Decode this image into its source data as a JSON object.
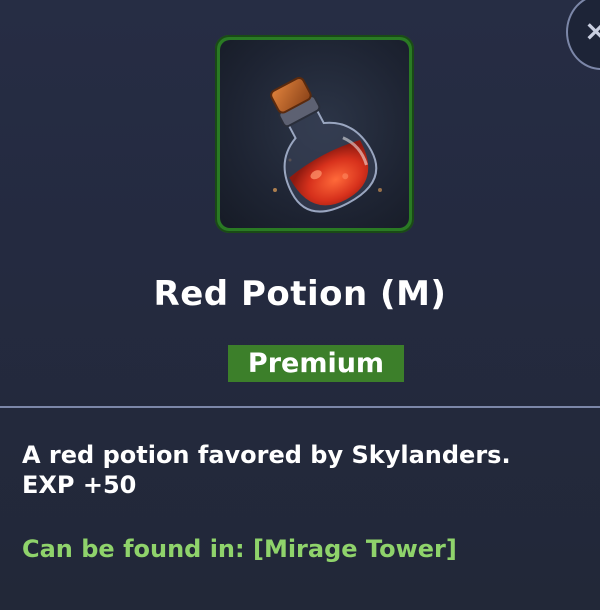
{
  "item": {
    "name": "Red Potion (M)",
    "rarity": "Premium",
    "description_line1": "A red potion favored by Skylanders.",
    "description_line2": "EXP +50",
    "location_prefix": "Can be found in:",
    "location": "[Mirage Tower]",
    "icon": "red-potion-icon"
  },
  "colors": {
    "frame": "#2a7a24",
    "rarity_bg": "#3c7f2a",
    "location_text": "#8fd36b",
    "panel_bg": "#242a40"
  }
}
